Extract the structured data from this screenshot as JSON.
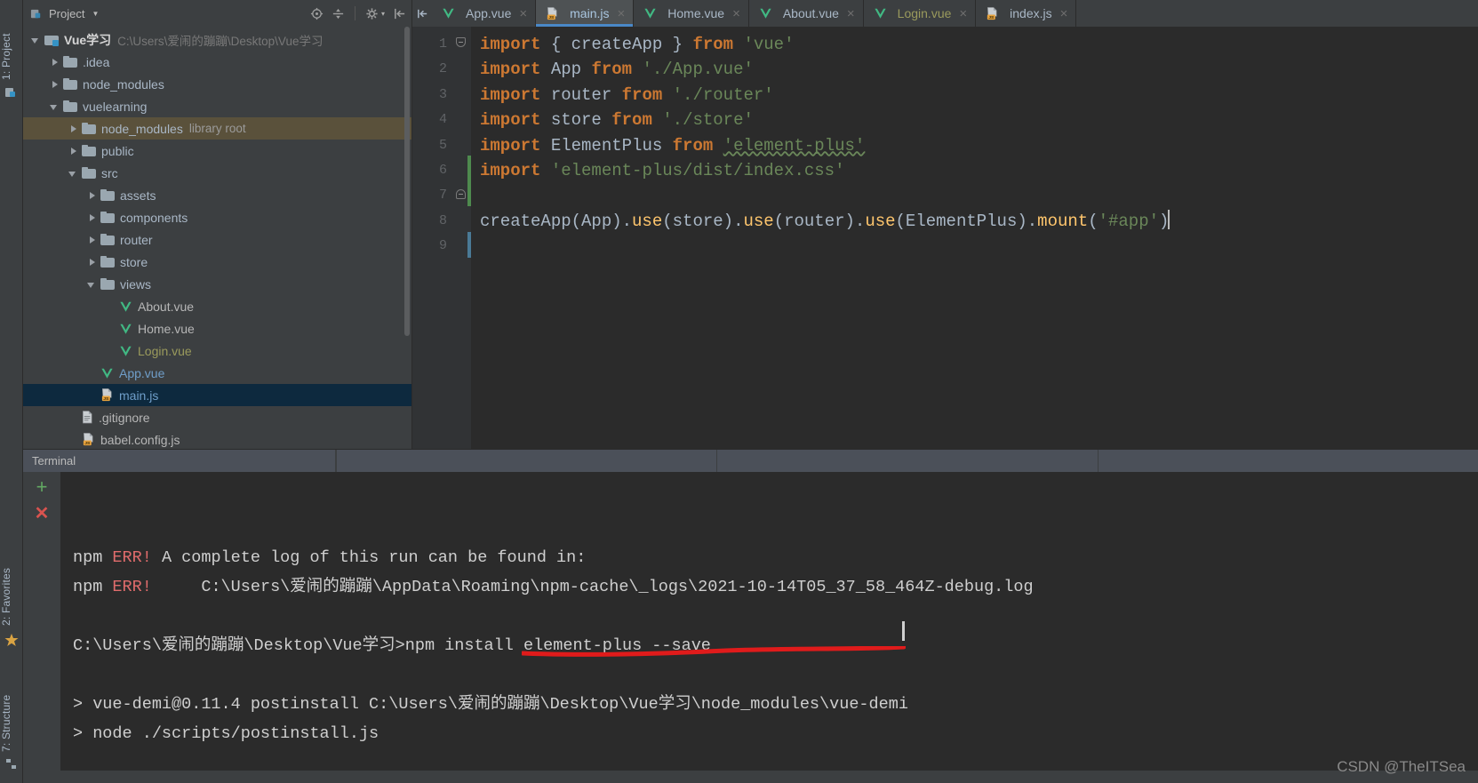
{
  "window": {
    "theme_bg": "#3c3f41",
    "editor_bg": "#2b2b2b",
    "accent": "#4a88c7",
    "watermark": "CSDN @TheITSea"
  },
  "left_rail": {
    "project_label": "1: Project",
    "favorites_label": "2: Favorites",
    "structure_label": "7: Structure",
    "icons": [
      "project-icon",
      "star-icon",
      "structure-icon"
    ]
  },
  "project_panel": {
    "title": "Project",
    "toolbar_icons": [
      "locate-icon",
      "collapse-all-icon",
      "settings-icon",
      "hide-icon"
    ],
    "tree": [
      {
        "depth": 0,
        "twisty": "open",
        "icon": "folder-module-icon",
        "label": "Vue学习",
        "bold": true,
        "suffix": "C:\\Users\\爱闹的蹦蹦\\Desktop\\Vue学习",
        "suffix_type": "path",
        "state": "none"
      },
      {
        "depth": 1,
        "twisty": "closed",
        "icon": "folder-icon",
        "label": ".idea",
        "state": "none"
      },
      {
        "depth": 1,
        "twisty": "closed",
        "icon": "folder-icon",
        "label": "node_modules",
        "state": "none"
      },
      {
        "depth": 1,
        "twisty": "open",
        "icon": "folder-icon",
        "label": "vuelearning",
        "state": "none"
      },
      {
        "depth": 2,
        "twisty": "closed",
        "icon": "folder-icon",
        "label": "node_modules",
        "suffix": "library root",
        "suffix_type": "lib",
        "state": "highlighted"
      },
      {
        "depth": 2,
        "twisty": "closed",
        "icon": "folder-icon",
        "label": "public",
        "state": "none"
      },
      {
        "depth": 2,
        "twisty": "open",
        "icon": "folder-icon",
        "label": "src",
        "state": "none"
      },
      {
        "depth": 3,
        "twisty": "closed",
        "icon": "folder-icon",
        "label": "assets",
        "state": "none"
      },
      {
        "depth": 3,
        "twisty": "closed",
        "icon": "folder-icon",
        "label": "components",
        "state": "none"
      },
      {
        "depth": 3,
        "twisty": "closed",
        "icon": "folder-icon",
        "label": "router",
        "state": "none"
      },
      {
        "depth": 3,
        "twisty": "closed",
        "icon": "folder-icon",
        "label": "store",
        "state": "none"
      },
      {
        "depth": 3,
        "twisty": "open",
        "icon": "folder-icon",
        "label": "views",
        "state": "none"
      },
      {
        "depth": 4,
        "twisty": "none",
        "icon": "vue-file-icon",
        "label": "About.vue",
        "color": "white",
        "state": "none"
      },
      {
        "depth": 4,
        "twisty": "none",
        "icon": "vue-file-icon",
        "label": "Home.vue",
        "color": "white",
        "state": "none"
      },
      {
        "depth": 4,
        "twisty": "none",
        "icon": "vue-file-icon",
        "label": "Login.vue",
        "color": "olive",
        "state": "none"
      },
      {
        "depth": 3,
        "twisty": "none",
        "icon": "vue-file-icon",
        "label": "App.vue",
        "color": "blue",
        "state": "none"
      },
      {
        "depth": 3,
        "twisty": "none",
        "icon": "js-file-icon",
        "label": "main.js",
        "color": "blue",
        "state": "selected"
      },
      {
        "depth": 2,
        "twisty": "none",
        "icon": "gitignore-file-icon",
        "label": ".gitignore",
        "color": "white",
        "state": "none"
      },
      {
        "depth": 2,
        "twisty": "none",
        "icon": "js-file-icon",
        "label": "babel.config.js",
        "color": "white",
        "state": "none"
      }
    ]
  },
  "editor": {
    "tabs": [
      {
        "label": "App.vue",
        "icon": "vue-file-icon",
        "active": false,
        "color": "normal"
      },
      {
        "label": "main.js",
        "icon": "js-file-icon",
        "active": true,
        "color": "active"
      },
      {
        "label": "Home.vue",
        "icon": "vue-file-icon",
        "active": false,
        "color": "normal"
      },
      {
        "label": "About.vue",
        "icon": "vue-file-icon",
        "active": false,
        "color": "normal"
      },
      {
        "label": "Login.vue",
        "icon": "vue-file-icon",
        "active": false,
        "color": "modified"
      },
      {
        "label": "index.js",
        "icon": "js-file-icon",
        "active": false,
        "color": "normal"
      }
    ],
    "close_glyph": "×",
    "line_numbers": [
      "1",
      "2",
      "3",
      "4",
      "5",
      "6",
      "7",
      "8",
      "9"
    ],
    "lines": [
      [
        {
          "t": "import",
          "c": "kw"
        },
        {
          "t": " { createApp } ",
          "c": "ident"
        },
        {
          "t": "from",
          "c": "kw"
        },
        {
          "t": " ",
          "c": "ident"
        },
        {
          "t": "'vue'",
          "c": "str"
        }
      ],
      [
        {
          "t": "import",
          "c": "kw"
        },
        {
          "t": " App ",
          "c": "ident"
        },
        {
          "t": "from",
          "c": "kw"
        },
        {
          "t": " ",
          "c": "ident"
        },
        {
          "t": "'./App.vue'",
          "c": "str"
        }
      ],
      [
        {
          "t": "import",
          "c": "kw"
        },
        {
          "t": " router ",
          "c": "ident"
        },
        {
          "t": "from",
          "c": "kw"
        },
        {
          "t": " ",
          "c": "ident"
        },
        {
          "t": "'./router'",
          "c": "str"
        }
      ],
      [
        {
          "t": "import",
          "c": "kw"
        },
        {
          "t": " store ",
          "c": "ident"
        },
        {
          "t": "from",
          "c": "kw"
        },
        {
          "t": " ",
          "c": "ident"
        },
        {
          "t": "'./store'",
          "c": "str"
        }
      ],
      [
        {
          "t": "import",
          "c": "kw"
        },
        {
          "t": " ElementPlus ",
          "c": "ident"
        },
        {
          "t": "from",
          "c": "kw"
        },
        {
          "t": " ",
          "c": "ident"
        },
        {
          "t": "'element-plus'",
          "c": "str wavy"
        }
      ],
      [
        {
          "t": "import",
          "c": "kw"
        },
        {
          "t": " ",
          "c": "ident"
        },
        {
          "t": "'element-plus/dist/index.css'",
          "c": "str"
        }
      ],
      [],
      [
        {
          "t": "createApp(App).",
          "c": "ident"
        },
        {
          "t": "use",
          "c": "fn"
        },
        {
          "t": "(store).",
          "c": "ident"
        },
        {
          "t": "use",
          "c": "fn"
        },
        {
          "t": "(router).",
          "c": "ident"
        },
        {
          "t": "use",
          "c": "fn"
        },
        {
          "t": "(ElementPlus).",
          "c": "ident"
        },
        {
          "t": "mount",
          "c": "fn"
        },
        {
          "t": "(",
          "c": "ident"
        },
        {
          "t": "'#app'",
          "c": "str"
        },
        {
          "t": ")",
          "c": "ident"
        }
      ],
      []
    ]
  },
  "terminal": {
    "tab_label": "Terminal",
    "rail_icons": [
      "add-terminal-icon",
      "close-terminal-icon"
    ],
    "output": [
      [
        {
          "t": "npm ",
          "c": "plain"
        },
        {
          "t": "ERR!",
          "c": "err"
        },
        {
          "t": " A complete log of this run can be found in:",
          "c": "plain"
        }
      ],
      [
        {
          "t": "npm ",
          "c": "plain"
        },
        {
          "t": "ERR!",
          "c": "err"
        },
        {
          "t": "     C:\\Users\\爱闹的蹦蹦\\AppData\\Roaming\\npm-cache\\_logs\\2021-10-14T05_37_58_464Z-debug.log",
          "c": "plain"
        }
      ],
      [],
      [
        {
          "t": "C:\\Users\\爱闹的蹦蹦\\Desktop\\Vue学习>npm install element-plus --save",
          "c": "plain"
        }
      ],
      [],
      [
        {
          "t": "> vue-demi@0.11.4 postinstall C:\\Users\\爱闹的蹦蹦\\Desktop\\Vue学习\\node_modules\\vue-demi",
          "c": "plain"
        }
      ],
      [
        {
          "t": "> node ./scripts/postinstall.js",
          "c": "plain"
        }
      ]
    ],
    "annotation": {
      "type": "red-underline",
      "color": "#e01b1b",
      "target": "npm install element-plus --save"
    }
  }
}
